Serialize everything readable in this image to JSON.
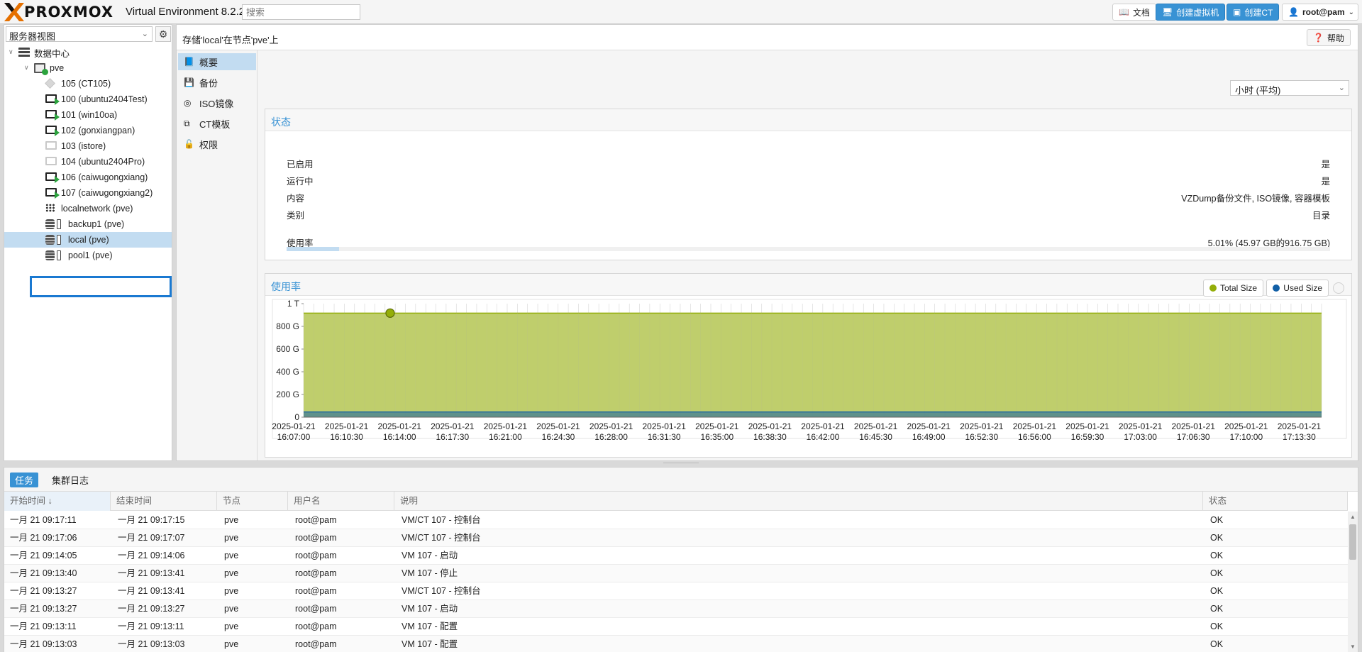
{
  "topbar": {
    "logo_text": "PROXMOX",
    "version": "Virtual Environment 8.2.2",
    "search_placeholder": "搜索",
    "docs_label": "文档",
    "create_vm_label": "创建虚拟机",
    "create_ct_label": "创建CT",
    "user_label": "root@pam"
  },
  "sidebar": {
    "view_select": "服务器视图",
    "tree": [
      {
        "label": "数据中心",
        "icon": "datacenter-icon",
        "level": 0
      },
      {
        "label": "pve",
        "icon": "node-icon",
        "level": 1
      },
      {
        "label": "105 (CT105)",
        "icon": "container-icon",
        "level": 2
      },
      {
        "label": "100 (ubuntu2404Test)",
        "icon": "vm-running-icon",
        "level": 2
      },
      {
        "label": "101 (win10oa)",
        "icon": "vm-running-icon",
        "level": 2
      },
      {
        "label": "102 (gonxiangpan)",
        "icon": "vm-running-icon",
        "level": 2
      },
      {
        "label": "103 (istore)",
        "icon": "vm-stopped-icon",
        "level": 2
      },
      {
        "label": "104 (ubuntu2404Pro)",
        "icon": "vm-stopped-icon",
        "level": 2
      },
      {
        "label": "106 (caiwugongxiang)",
        "icon": "vm-running-icon",
        "level": 2
      },
      {
        "label": "107 (caiwugongxiang2)",
        "icon": "vm-running-icon",
        "level": 2
      },
      {
        "label": "localnetwork (pve)",
        "icon": "network-icon",
        "level": 2
      },
      {
        "label": "backup1 (pve)",
        "icon": "storage-icon",
        "level": 2
      },
      {
        "label": "local (pve)",
        "icon": "storage-icon",
        "level": 2
      },
      {
        "label": "pool1 (pve)",
        "icon": "storage-icon",
        "level": 2
      }
    ]
  },
  "main": {
    "title": "存储'local'在节点'pve'上",
    "help_label": "帮助",
    "nav": [
      {
        "label": "概要",
        "icon": "book-icon"
      },
      {
        "label": "备份",
        "icon": "floppy-icon"
      },
      {
        "label": "ISO镜像",
        "icon": "disc-icon"
      },
      {
        "label": "CT模板",
        "icon": "template-icon"
      },
      {
        "label": "权限",
        "icon": "unlock-icon"
      }
    ],
    "timeframe": "小时 (平均)",
    "status": {
      "title": "状态",
      "rows": [
        {
          "label": "已启用",
          "value": "是"
        },
        {
          "label": "运行中",
          "value": "是"
        },
        {
          "label": "内容",
          "value": "VZDump备份文件, ISO镜像, 容器模板"
        },
        {
          "label": "类别",
          "value": "目录"
        }
      ],
      "usage_label": "使用率",
      "usage_value": "5.01% (45.97 GB的916.75 GB)",
      "usage_fraction": 0.0501
    },
    "usage_chart_title": "使用率"
  },
  "chart_data": {
    "type": "area",
    "title": "使用率",
    "legend": [
      "Total Size",
      "Used Size"
    ],
    "legend_colors": {
      "Total Size": "#94ae0a",
      "Used Size": "#115fa6"
    },
    "y_ticks": [
      "0",
      "200 G",
      "400 G",
      "600 G",
      "800 G",
      "1 T"
    ],
    "ylim": [
      0,
      1000
    ],
    "x_ticks": [
      [
        "2025-01-21",
        "16:07:00"
      ],
      [
        "2025-01-21",
        "16:10:30"
      ],
      [
        "2025-01-21",
        "16:14:00"
      ],
      [
        "2025-01-21",
        "16:17:30"
      ],
      [
        "2025-01-21",
        "16:21:00"
      ],
      [
        "2025-01-21",
        "16:24:30"
      ],
      [
        "2025-01-21",
        "16:28:00"
      ],
      [
        "2025-01-21",
        "16:31:30"
      ],
      [
        "2025-01-21",
        "16:35:00"
      ],
      [
        "2025-01-21",
        "16:38:30"
      ],
      [
        "2025-01-21",
        "16:42:00"
      ],
      [
        "2025-01-21",
        "16:45:30"
      ],
      [
        "2025-01-21",
        "16:49:00"
      ],
      [
        "2025-01-21",
        "16:52:30"
      ],
      [
        "2025-01-21",
        "16:56:00"
      ],
      [
        "2025-01-21",
        "16:59:30"
      ],
      [
        "2025-01-21",
        "17:03:00"
      ],
      [
        "2025-01-21",
        "17:06:30"
      ],
      [
        "2025-01-21",
        "17:10:00"
      ],
      [
        "2025-01-21",
        "17:13:30"
      ]
    ],
    "series": [
      {
        "name": "Total Size",
        "value": 916.75
      },
      {
        "name": "Used Size",
        "value": 45.97
      }
    ],
    "highlight_index": 17
  },
  "tasks": {
    "tabs": [
      "任务",
      "集群日志"
    ],
    "columns": [
      "开始时间 ↓",
      "结束时间",
      "节点",
      "用户名",
      "说明",
      "状态"
    ],
    "rows": [
      [
        "一月 21 09:17:11",
        "一月 21 09:17:15",
        "pve",
        "root@pam",
        "VM/CT 107 - 控制台",
        "OK"
      ],
      [
        "一月 21 09:17:06",
        "一月 21 09:17:07",
        "pve",
        "root@pam",
        "VM/CT 107 - 控制台",
        "OK"
      ],
      [
        "一月 21 09:14:05",
        "一月 21 09:14:06",
        "pve",
        "root@pam",
        "VM 107 - 启动",
        "OK"
      ],
      [
        "一月 21 09:13:40",
        "一月 21 09:13:41",
        "pve",
        "root@pam",
        "VM 107 - 停止",
        "OK"
      ],
      [
        "一月 21 09:13:27",
        "一月 21 09:13:41",
        "pve",
        "root@pam",
        "VM/CT 107 - 控制台",
        "OK"
      ],
      [
        "一月 21 09:13:27",
        "一月 21 09:13:27",
        "pve",
        "root@pam",
        "VM 107 - 启动",
        "OK"
      ],
      [
        "一月 21 09:13:11",
        "一月 21 09:13:11",
        "pve",
        "root@pam",
        "VM 107 - 配置",
        "OK"
      ],
      [
        "一月 21 09:13:03",
        "一月 21 09:13:03",
        "pve",
        "root@pam",
        "VM 107 - 配置",
        "OK"
      ]
    ]
  }
}
